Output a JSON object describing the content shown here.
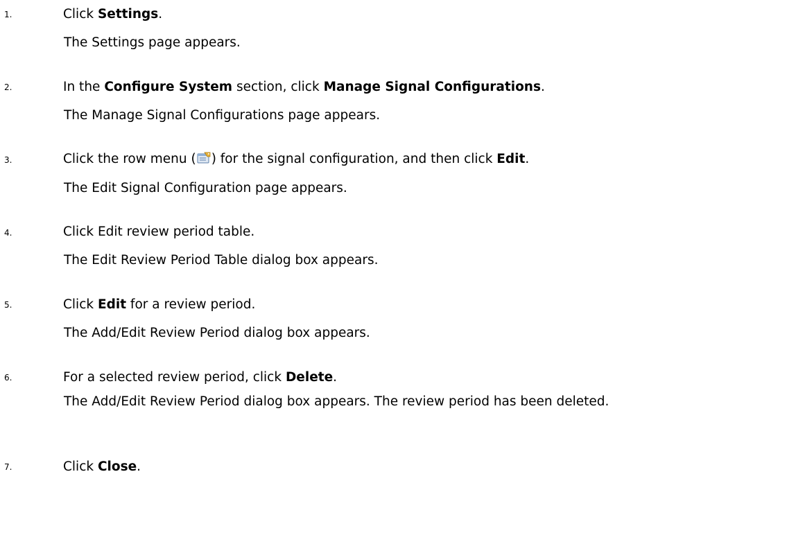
{
  "steps": [
    {
      "number": "1.",
      "instruction": {
        "pre": "Click ",
        "bold": "Settings",
        "post": "."
      },
      "result": "The Settings page appears."
    },
    {
      "number": "2.",
      "instruction": {
        "pre": "In the ",
        "bold1": "Configure System",
        "mid": " section, click ",
        "bold2": "Manage Signal Configurations",
        "post": "."
      },
      "result": "The Manage Signal Configurations page appears."
    },
    {
      "number": "3.",
      "instruction": {
        "pre": "Click the row menu (",
        "icon": "row-menu-icon",
        "mid": ") for the signal configuration, and then click ",
        "bold": "Edit",
        "post": "."
      },
      "result": "The Edit Signal Configuration page appears."
    },
    {
      "number": "4.",
      "instruction": {
        "text": "Click Edit review period table."
      },
      "result": "The Edit Review Period Table dialog box appears."
    },
    {
      "number": "5.",
      "instruction": {
        "pre": "Click ",
        "bold": "Edit",
        "post": " for a review period."
      },
      "result": "The Add/Edit Review Period dialog box appears."
    },
    {
      "number": "6.",
      "instruction": {
        "pre": "For a selected review period, click ",
        "bold": "Delete",
        "post": "."
      },
      "result": "The Add/Edit Review Period dialog box appears. The review period has been deleted."
    },
    {
      "number": "7.",
      "instruction": {
        "pre": "Click ",
        "bold": "Close",
        "post": "."
      }
    }
  ]
}
